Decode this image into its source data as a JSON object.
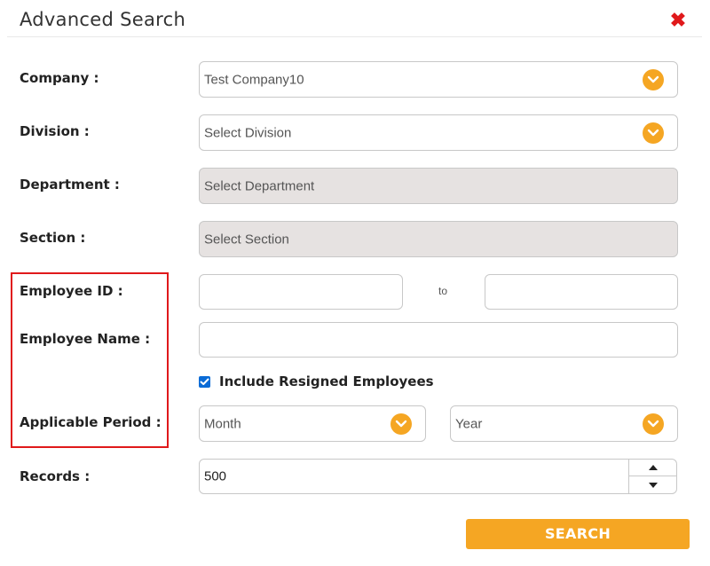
{
  "dialog": {
    "title": "Advanced Search",
    "close_icon": "close-icon"
  },
  "labels": {
    "company": "Company :",
    "division": "Division :",
    "department": "Department :",
    "section": "Section :",
    "employee_id": "Employee ID :",
    "employee_name": "Employee Name :",
    "applicable_period": "Applicable Period :",
    "records": "Records :"
  },
  "fields": {
    "company": {
      "value": "Test Company10",
      "enabled": true
    },
    "division": {
      "value": "Select Division",
      "enabled": true
    },
    "department": {
      "value": "Select Department",
      "enabled": false
    },
    "section": {
      "value": "Select Section",
      "enabled": false
    },
    "employee_id_from": {
      "value": ""
    },
    "employee_id_to": {
      "value": ""
    },
    "employee_id_separator": "to",
    "employee_name": {
      "value": ""
    },
    "month": {
      "value": "Month"
    },
    "year": {
      "value": "Year"
    },
    "records": {
      "value": "500"
    }
  },
  "include_resigned": {
    "label": "Include Resigned Employees",
    "checked": true
  },
  "search_button": {
    "label": "SEARCH"
  },
  "colors": {
    "accent": "#f5a623",
    "close": "#e0191b",
    "highlight_box": "#e0191b",
    "checkbox": "#0b6bd6",
    "disabled_field": "#e6e2e1"
  }
}
